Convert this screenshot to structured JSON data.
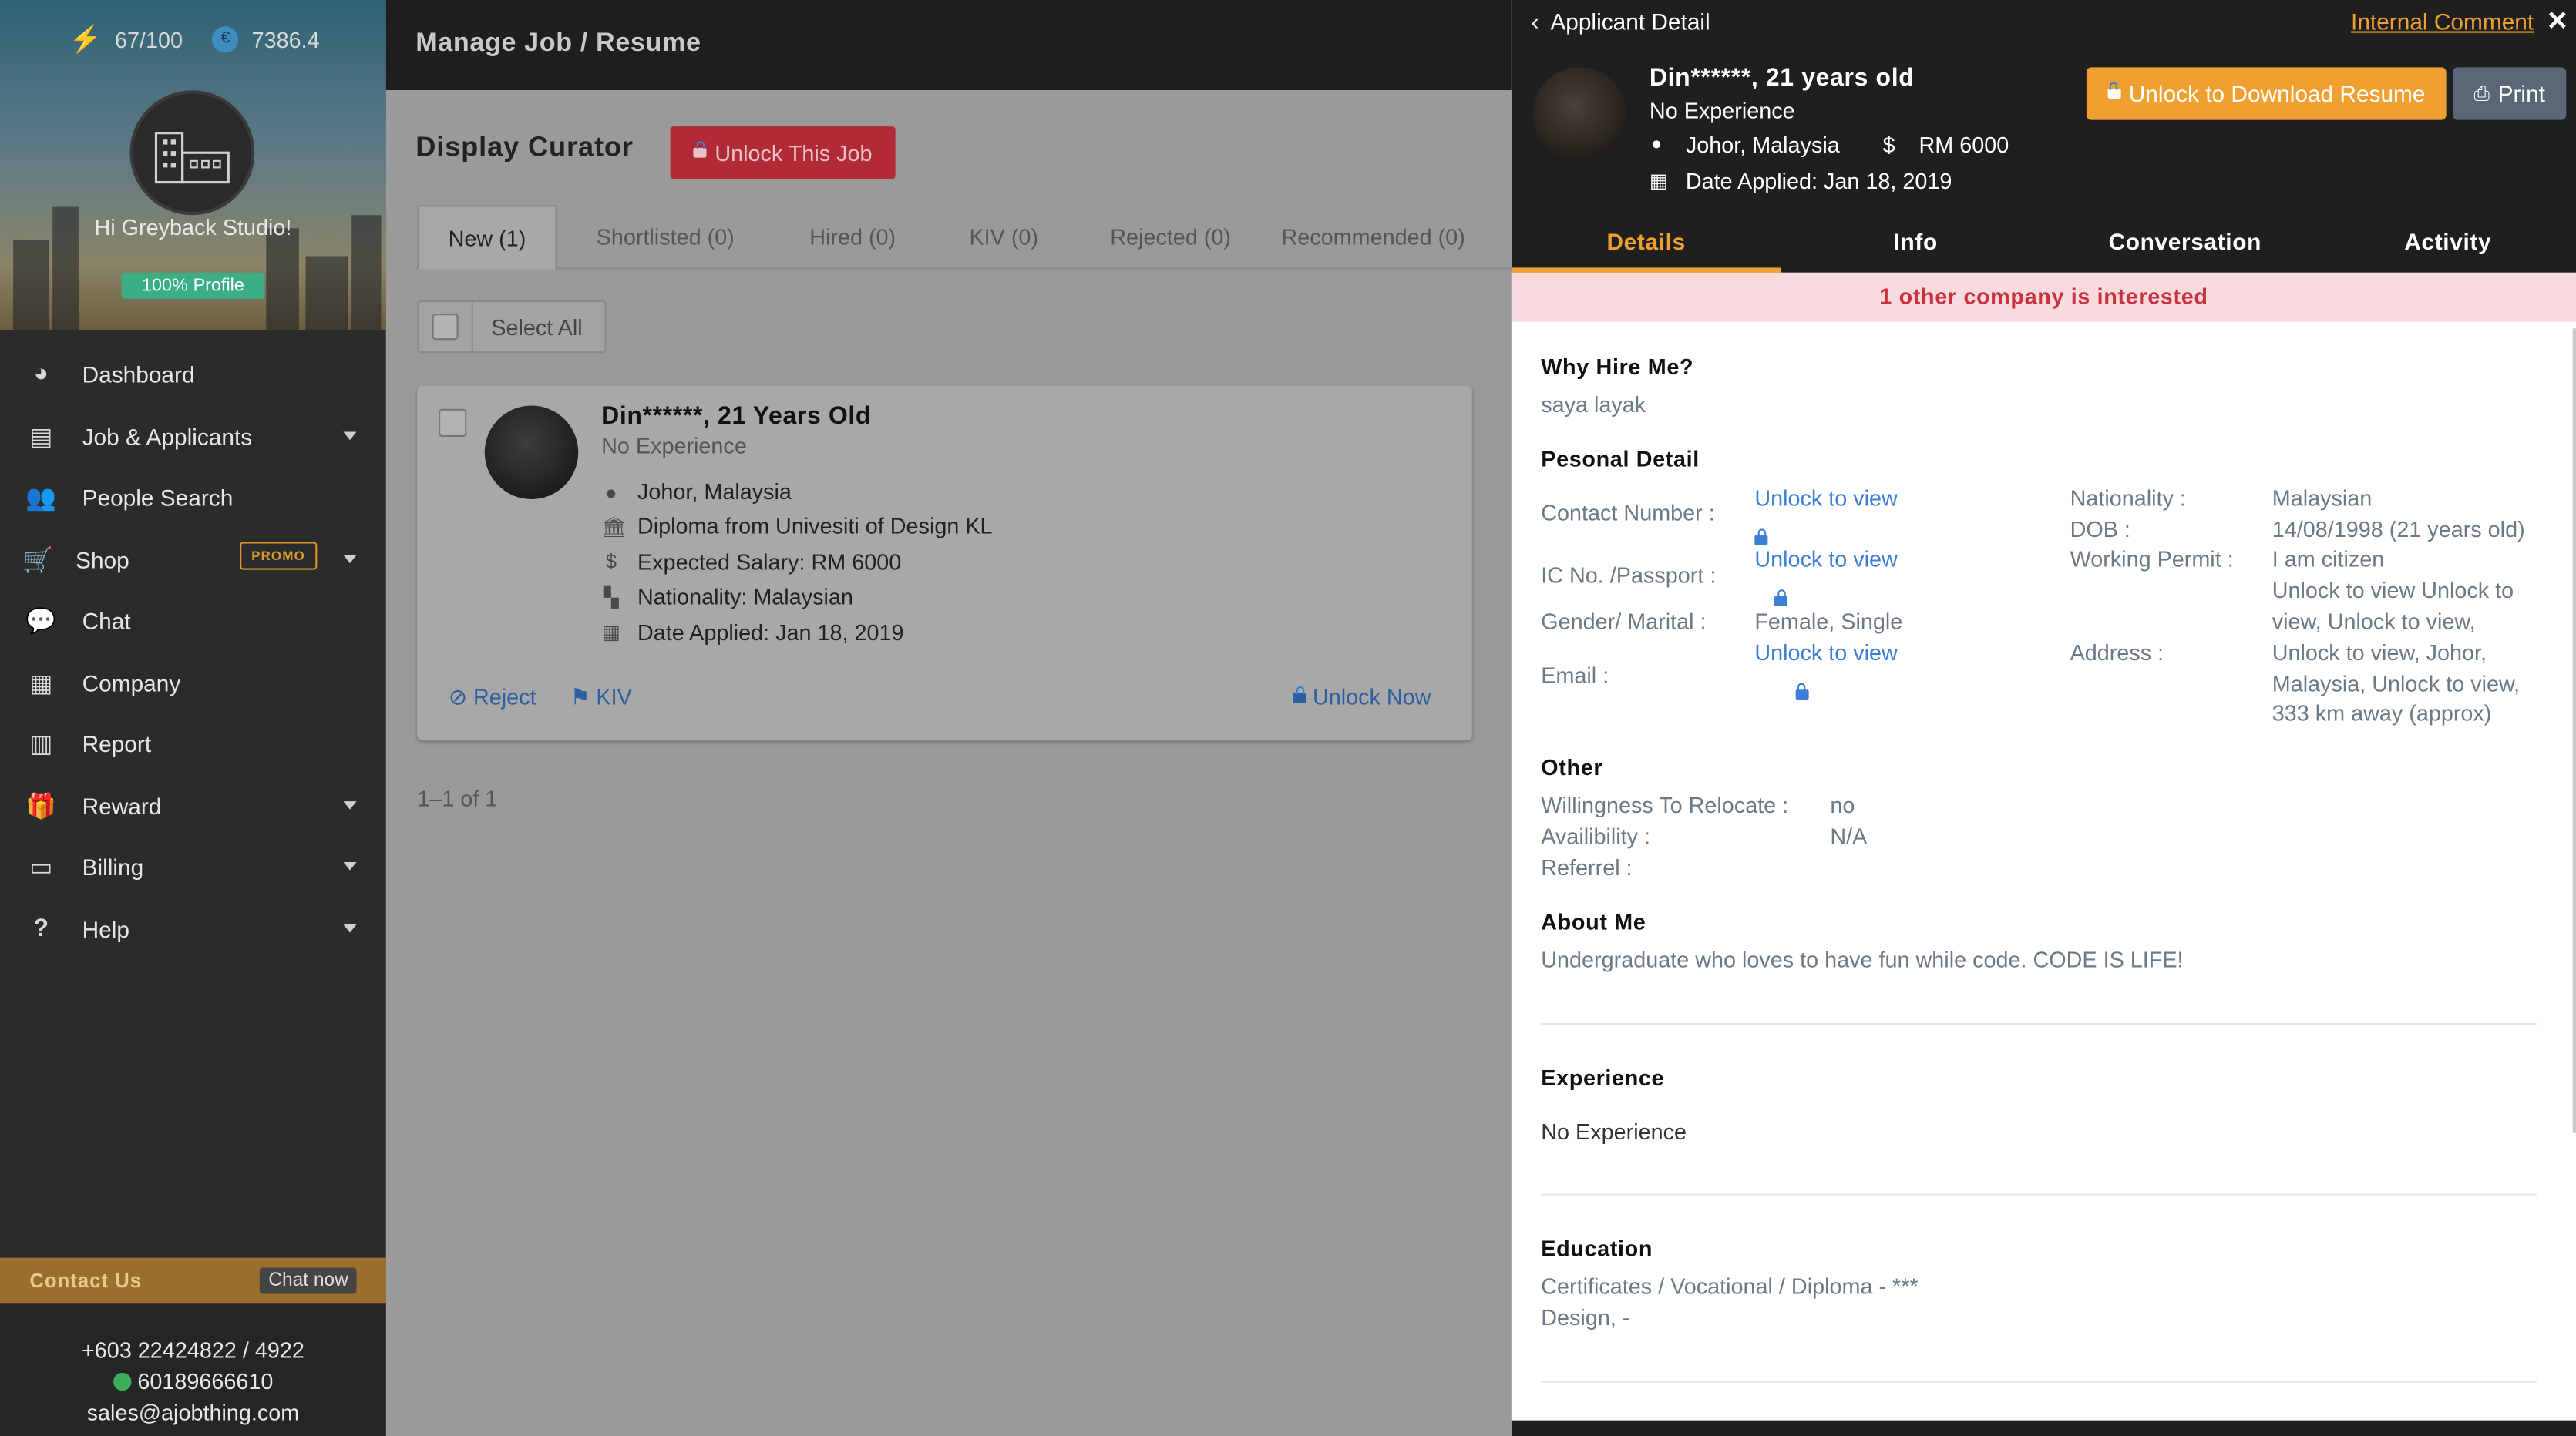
{
  "sidebar": {
    "credits": "67/100",
    "coins": "7386.4",
    "greeting": "Hi Greyback Studio!",
    "profile_badge": "100% Profile",
    "nav": [
      {
        "label": "Dashboard",
        "icon": "dashboard-icon",
        "caret": false
      },
      {
        "label": "Job & Applicants",
        "icon": "document-icon",
        "caret": true
      },
      {
        "label": "People Search",
        "icon": "people-icon",
        "caret": false
      },
      {
        "label": "Shop",
        "icon": "cart-icon",
        "caret": true,
        "promo": "PROMO"
      },
      {
        "label": "Chat",
        "icon": "chat-icon",
        "caret": false
      },
      {
        "label": "Company",
        "icon": "building-icon",
        "caret": false
      },
      {
        "label": "Report",
        "icon": "bar-chart-icon",
        "caret": false
      },
      {
        "label": "Reward",
        "icon": "gift-icon",
        "caret": true
      },
      {
        "label": "Billing",
        "icon": "credit-card-icon",
        "caret": true
      },
      {
        "label": "Help",
        "icon": "question-icon",
        "caret": true
      }
    ],
    "contact_title": "Contact Us",
    "chat_now": "Chat now",
    "phone": "+603 22424822 / 4922",
    "whatsapp": "60189666610",
    "email": "sales@ajobthing.com"
  },
  "header": {
    "title": "Manage Job / Resume"
  },
  "main": {
    "page_title": "Display Curator",
    "unlock_job": "Unlock This Job",
    "tabs": [
      "New (1)",
      "Shortlisted (0)",
      "Hired (0)",
      "KIV (0)",
      "Rejected (0)",
      "Recommended (0)"
    ],
    "select_all": "Select All",
    "card": {
      "name": "Din******, 21 Years Old",
      "experience": "No Experience",
      "location": "Johor, Malaysia",
      "education": "Diploma from Univesiti of Design KL",
      "salary": "Expected Salary: RM 6000",
      "nationality": "Nationality: Malaysian",
      "date_applied": "Date Applied: Jan 18, 2019",
      "reject": "Reject",
      "kiv": "KIV",
      "unlock_now": "Unlock Now"
    },
    "pagination": "1–1 of 1"
  },
  "panel": {
    "title": "Applicant Detail",
    "internal_comment": "Internal Comment",
    "name": "Din******, 21 years old",
    "experience": "No Experience",
    "location": "Johor, Malaysia",
    "currency_symbol": "$",
    "salary": "RM 6000",
    "date_applied": "Date Applied: Jan 18, 2019",
    "unlock_resume": "Unlock to Download Resume",
    "print": "Print",
    "tabs": [
      "Details",
      "Info",
      "Conversation",
      "Activity"
    ],
    "interest_banner": "1 other company is interested",
    "why_hire_title": "Why Hire Me?",
    "why_hire_text": "saya layak",
    "personal_title": "Pesonal Detail",
    "contact_label": "Contact Number :",
    "unlock_text": "Unlock to view",
    "ic_label": "IC No. /Passport :",
    "gender_label": "Gender/ Marital :",
    "gender_value": "Female, Single",
    "email_label": "Email :",
    "nationality_label": "Nationality :",
    "nationality_value": "Malaysian",
    "dob_label": "DOB :",
    "dob_value": "14/08/1998 (21 years old)",
    "permit_label": "Working Permit :",
    "permit_value_1": "I am citizen",
    "permit_value_2": "Unlock to view Unlock to",
    "permit_value_3": "view, Unlock to view,",
    "address_label": "Address :",
    "address_value_1": "Unlock to view, Johor,",
    "address_value_2": "Malaysia, Unlock to view,",
    "address_value_3": "333 km away (approx)",
    "other_title": "Other",
    "relocate_label": "Willingness To Relocate :",
    "relocate_value": "no",
    "availability_label": "Availibility :",
    "availability_value": "N/A",
    "referral_label": "Referrel :",
    "about_title": "About Me",
    "about_text": "Undergraduate who loves to have fun while code. CODE IS LIFE!",
    "experience_title": "Experience",
    "experience_text": "No Experience",
    "education_title": "Education",
    "education_line1": "Certificates / Vocational / Diploma - ***",
    "education_line2": "Design, -"
  },
  "colors": {
    "accent_orange": "#f0a030",
    "danger_red": "#c6303e",
    "link_blue": "#3d7fd5",
    "banner_bg": "#f9dade",
    "banner_text": "#c9323f",
    "badge_green": "#3cae86"
  }
}
